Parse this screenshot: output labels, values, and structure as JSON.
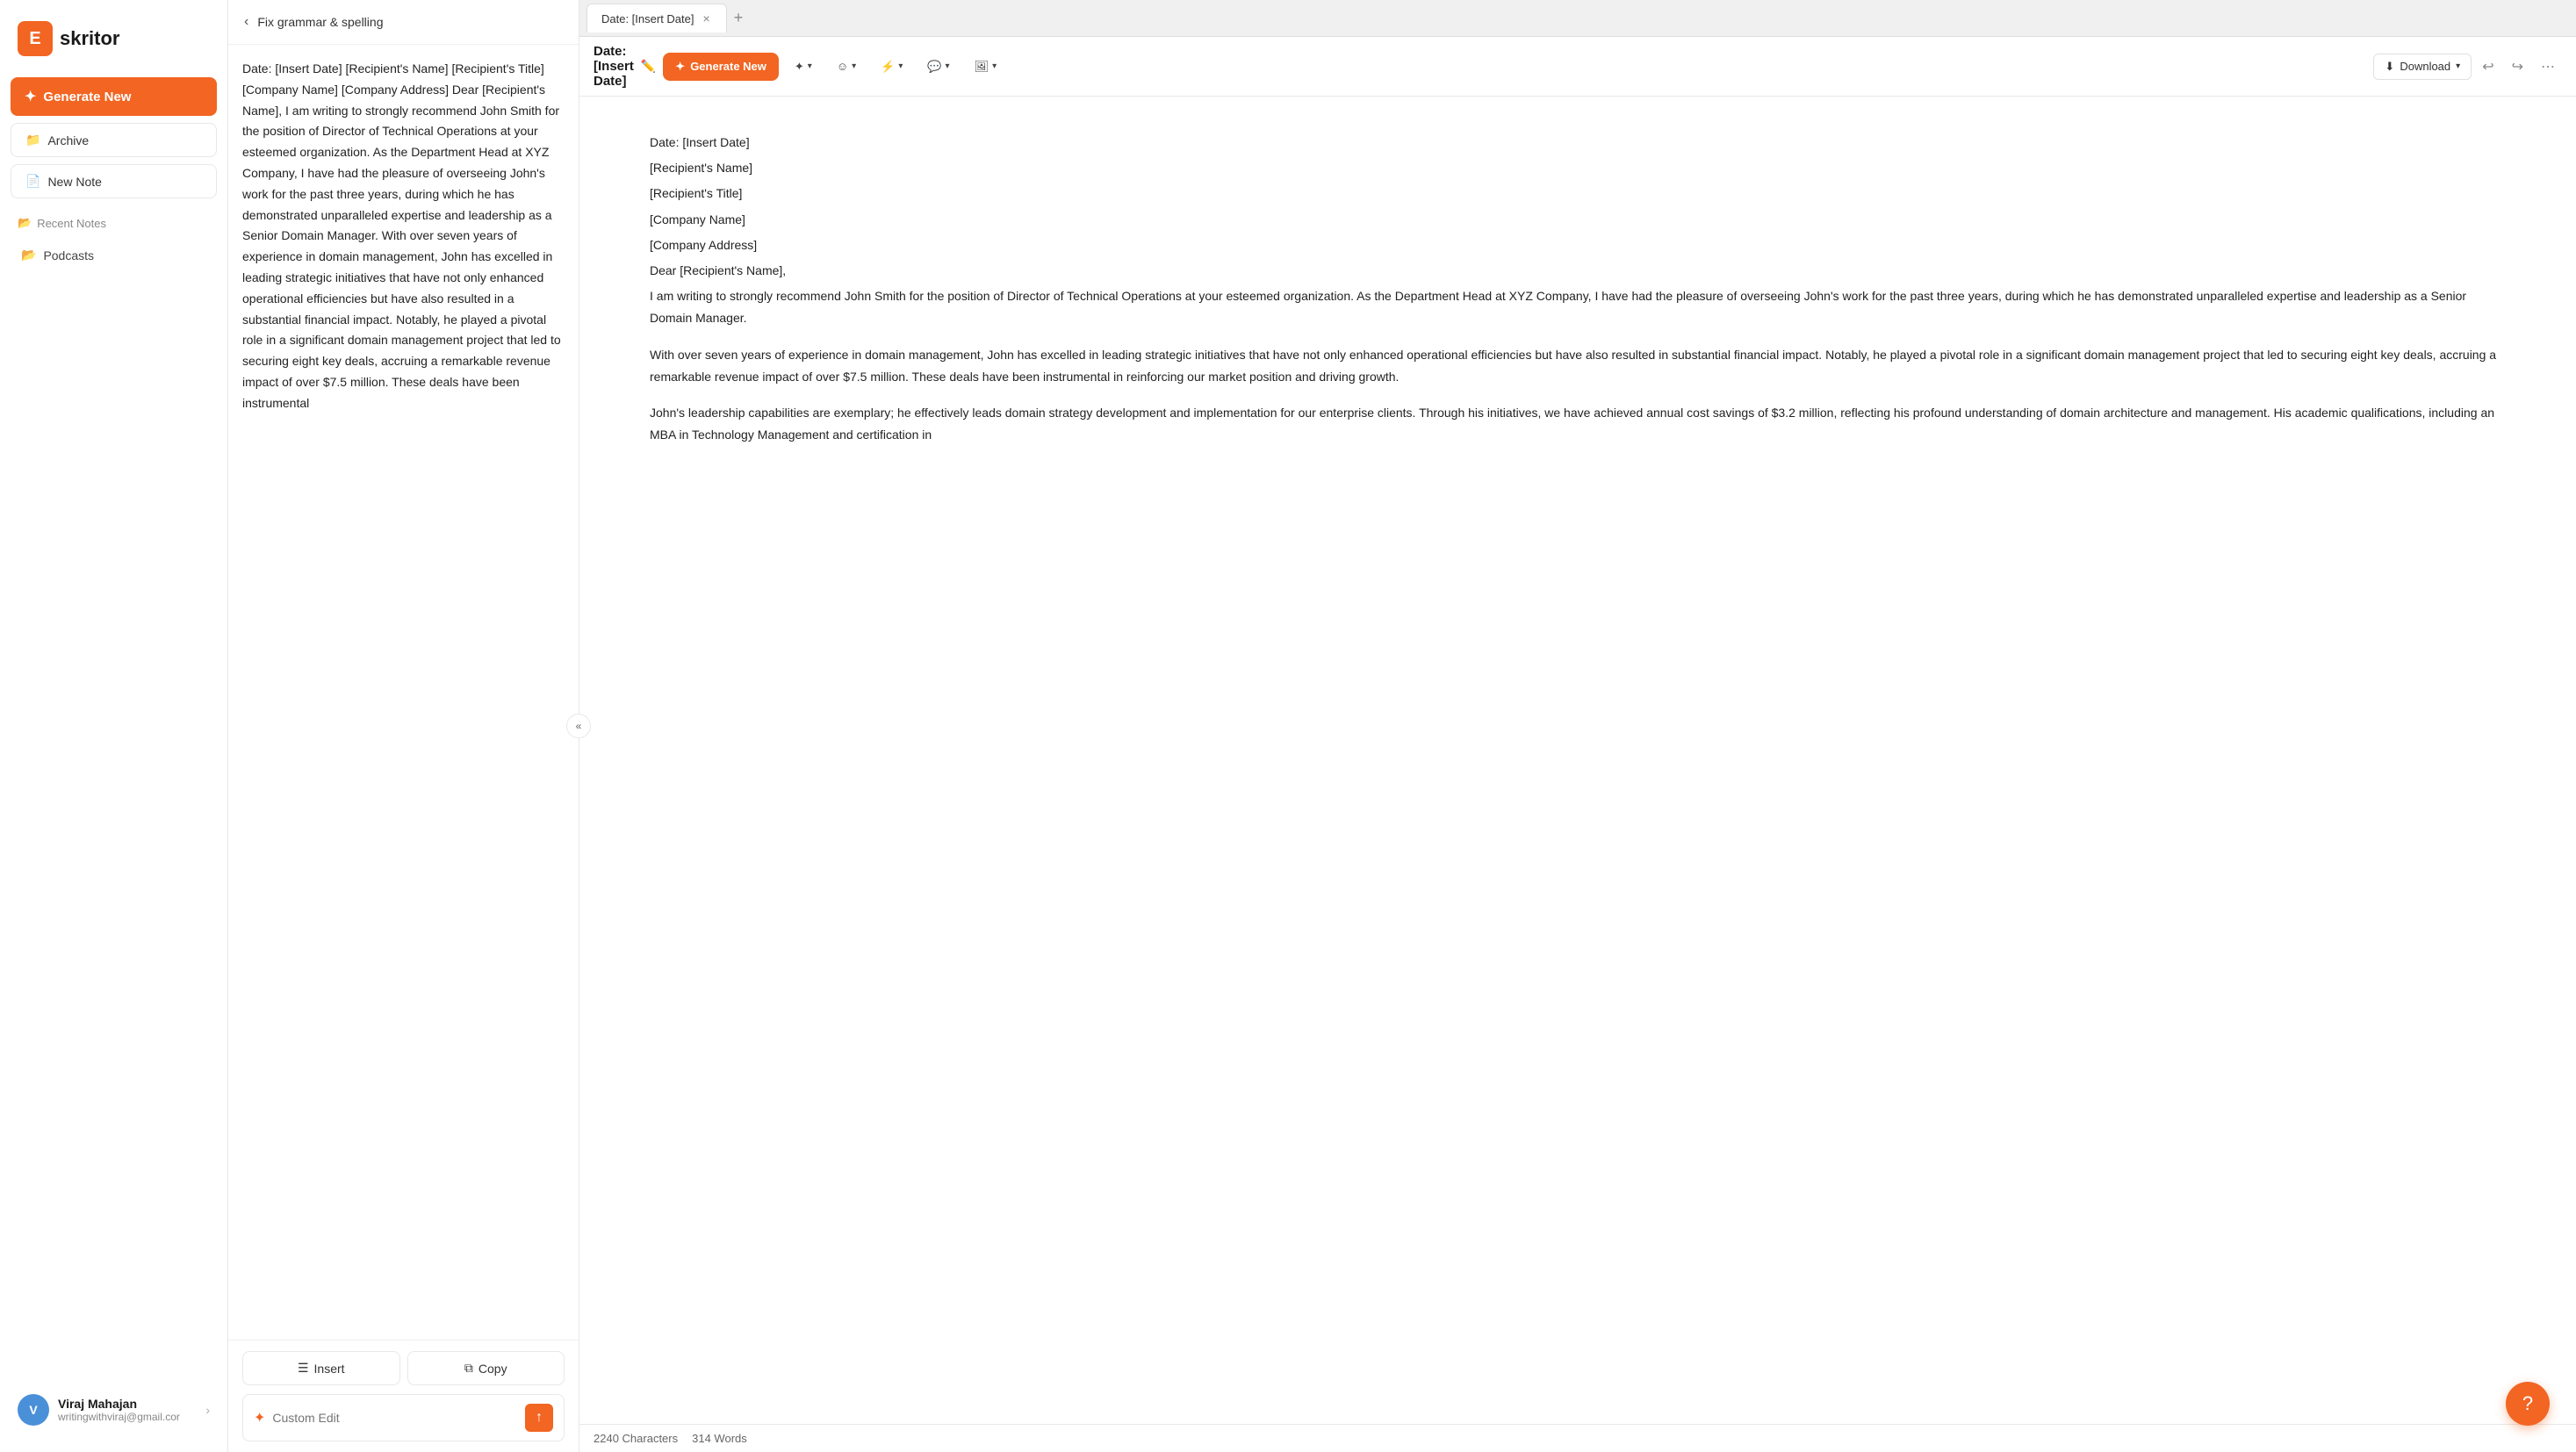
{
  "app": {
    "logo_letter": "E",
    "logo_name": "skritor"
  },
  "sidebar": {
    "generate_label": "Generate New",
    "archive_label": "Archive",
    "new_note_label": "New Note",
    "recent_notes_label": "Recent Notes",
    "podcasts_label": "Podcasts"
  },
  "user": {
    "initials": "V",
    "name": "Viraj Mahajan",
    "email": "writingwithviraj@gmail.cor"
  },
  "middle_panel": {
    "back_label": "Fix grammar & spelling",
    "document_text": "Date: [Insert Date] [Recipient's Name] [Recipient's Title] [Company Name] [Company Address] Dear [Recipient's Name], I am writing to strongly recommend John Smith for the position of Director of Technical Operations at your esteemed organization. As the Department Head at XYZ Company, I have had the pleasure of overseeing John's work for the past three years, during which he has demonstrated unparalleled expertise and leadership as a Senior Domain Manager. With over seven years of experience in domain management, John has excelled in leading strategic initiatives that have not only enhanced operational efficiencies but have also resulted in a substantial financial impact. Notably, he played a pivotal role in a significant domain management project that led to securing eight key deals, accruing a remarkable revenue impact of over $7.5 million. These deals have been instrumental",
    "insert_label": "Insert",
    "copy_label": "Copy",
    "custom_edit_placeholder": "Custom Edit",
    "custom_edit_value": ""
  },
  "editor": {
    "tab_title": "Date: [Insert Date]",
    "doc_title": "Date: [Insert Date]",
    "generate_label": "Generate New",
    "download_label": "Download",
    "toolbar": {
      "magic_label": "✦",
      "face_label": "☺",
      "wand_label": "⚡",
      "comment_label": "💬",
      "image_label": "🖼"
    },
    "characters": "2240 Characters",
    "words": "314 Words",
    "lines": [
      "Date: [Insert Date]",
      "[Recipient's Name]",
      "[Recipient's Title]",
      "[Company Name]",
      "[Company Address]",
      "Dear [Recipient's Name],"
    ],
    "paragraphs": [
      "I am writing to strongly recommend John Smith for the position of Director of Technical Operations at your esteemed organization. As the Department Head at XYZ Company, I have had the pleasure of overseeing John's work for the past three years, during which he has demonstrated unparalleled expertise and leadership as a Senior Domain Manager.",
      "With over seven years of experience in domain management, John has excelled in leading strategic initiatives that have not only enhanced operational efficiencies but have also resulted in substantial financial impact. Notably, he played a pivotal role in a significant domain management project that led to securing eight key deals, accruing a remarkable revenue impact of over $7.5 million. These deals have been instrumental in reinforcing our market position and driving growth.",
      "John's leadership capabilities are exemplary; he effectively leads domain strategy development and implementation for our enterprise clients. Through his initiatives, we have achieved annual cost savings of $3.2 million, reflecting his profound understanding of domain architecture and management. His academic qualifications, including an MBA in Technology Management and certification in"
    ]
  }
}
